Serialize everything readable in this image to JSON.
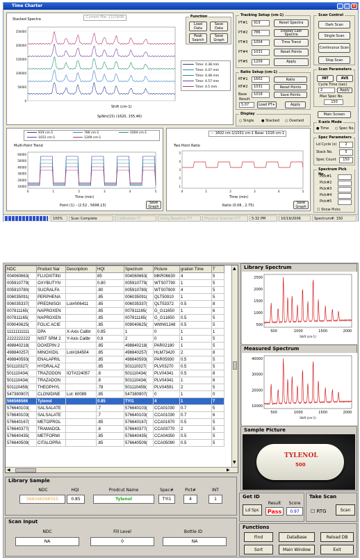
{
  "top": {
    "title": "Time Charter",
    "chart": {
      "label": "Stacked Spectra",
      "caption_box": "Current File: 11/19/06",
      "xlabel": "Shift (cm-1)",
      "readout": "SpNm(15) (1620, 155.46)",
      "y_ticks": [
        "250000",
        "200000",
        "150000",
        "100000",
        "50000",
        "0"
      ],
      "legend": [
        "Time: 4.38 mm",
        "Time: 4.47 mm",
        "Time: 4.48 mm",
        "Time: 4.57 mm",
        "Time: 4.5 mm"
      ]
    },
    "function_group": {
      "label": "Function",
      "buttons": [
        "Load Data",
        "Save Data",
        "Peak Search",
        "Save Graph"
      ]
    },
    "tracking": {
      "label": "Tracking Setup (cm-1)",
      "rows": [
        {
          "name": "PT#1",
          "value": "919",
          "button": "Reset Spectra"
        },
        {
          "name": "PT#2",
          "value": "786",
          "button": "Display Last Spectra"
        },
        {
          "name": "PT#3",
          "value": "1004",
          "button": "Time Trend"
        },
        {
          "name": "PT#4",
          "value": "1031",
          "button": "Reset Points"
        },
        {
          "name": "PT#5",
          "value": "1209",
          "button": "Apply"
        }
      ]
    },
    "ratio": {
      "label": "Ratio Setup (cm-1)",
      "rows": [
        {
          "name": "RT#1",
          "value": "1602",
          "button": "Ratio"
        },
        {
          "name": "RT#2",
          "value": "1031",
          "button": "Reset Points"
        },
        {
          "name": "Base",
          "value": "1016",
          "button": "Save Points"
        }
      ],
      "result_label": "Result",
      "result_value": "5.07",
      "load_button": "Load PT+",
      "apply_button": "Apply"
    },
    "display": {
      "label": "Display",
      "options": [
        "Single",
        "Stacked",
        "Overlaid"
      ]
    },
    "scan_control": {
      "label": "Scan Control",
      "buttons": [
        "Dark Scan",
        "Single Scan",
        "Continuous Scan",
        "Stop Scan"
      ]
    },
    "scan_params": {
      "label": "Scan Parameters",
      "int_label": "INT",
      "ave_label": "AVE",
      "cycle_label": "Cycle Time (sec)",
      "cycle_value": "2",
      "apply": "Apply",
      "max_label": "Max Spec No.",
      "max_value": "150",
      "main_screen": "Main Screen"
    },
    "xaxis_mode": {
      "label": "X-axis Mode",
      "options": [
        "Time",
        "Spec No."
      ]
    },
    "spec_params": {
      "label": "Spec Parameters",
      "rows": [
        {
          "name": "Ld Cycle (s)",
          "value": "2"
        },
        {
          "name": "Stack No.",
          "value": "5"
        },
        {
          "name": "Spec Count",
          "value": "150"
        }
      ]
    },
    "pick": {
      "label": "Spectrum Pick No.",
      "rows": [
        "Pick#1",
        "Pick#2",
        "Pick#3",
        "Pick#4",
        "Pick#5"
      ],
      "show": "Show Picks"
    },
    "trend": {
      "label": "Multi-Point Trend",
      "legend": [
        "919 cm-1",
        "786 cm-1",
        "1004 cm-1",
        "1031 cm-1",
        "1209 cm-1"
      ],
      "xlabel": "Time (min)",
      "readout": "Point (1) - (2.52 , 5698.13)",
      "save": "Save Graph",
      "x_ticks": [
        "0",
        "1",
        "2",
        "3",
        "4",
        "5"
      ],
      "y_ticks": [
        "60000",
        "50000",
        "40000",
        "30000",
        "20000",
        "10000"
      ]
    },
    "tpratio": {
      "label": "Two Point Ratio",
      "legend": "1602 cm-1/1031 cm-1 Base: 1016 cm-1",
      "xlabel": "Time (min)",
      "readout": "Ratio (0.06 , 2.75)",
      "save": "Save Graph",
      "x_ticks": [
        "0",
        "1",
        "2",
        "3",
        "4",
        "5"
      ],
      "y_ticks": [
        "5",
        "4",
        "3",
        "2",
        "1"
      ]
    },
    "status": [
      "100%",
      "Scan Complete",
      "Calibration:??",
      "Using Baseline:???",
      "Physical Scanner:???",
      "5:32 PM",
      "10/19/2006",
      "Spectrum#: 150"
    ]
  },
  "bottom": {
    "table": {
      "columns": [
        "NDC",
        "Product Nar",
        "Description",
        "HQI",
        "Spectrum",
        "Picture",
        "gration Time",
        "T"
      ],
      "rows": [
        [
          "004060663(",
          "FLUOXITINI",
          "",
          "85",
          "004060663(",
          "MKR06630",
          "4",
          "5"
        ],
        [
          "005910779(",
          "OXYBUTYN",
          "",
          "0.80",
          "005910779(",
          "WTS07790",
          "1",
          "5"
        ],
        [
          "005910780(",
          "SUCRALFA",
          "",
          ".80",
          "005910780(",
          "WTS07800",
          "4",
          "5"
        ],
        [
          "006035091(",
          "PERPHENA",
          "",
          ".85",
          "006035091(",
          "QLT50910",
          "1",
          "5"
        ],
        [
          "006035337(",
          "PREDNISOI",
          "Lot#006411",
          ".85",
          "006035337(",
          "QLT53372",
          "0.5",
          "8"
        ],
        [
          "007811165(",
          "NAPROXEN",
          "",
          ".85",
          "007811165(",
          "G_G11650",
          "1",
          "6"
        ],
        [
          "007811165(",
          "NAPROXEN",
          "",
          ".85",
          "007811165(",
          "G_G11650",
          "0.5",
          "5"
        ],
        [
          "009040625(",
          "FOLIC ACIE",
          "",
          ".85",
          "009040625(",
          "WWW1248",
          "0.5",
          "5"
        ],
        [
          "11111111111",
          "DPA",
          "X-Axis Calibr",
          "0.85",
          "1",
          "0",
          "1",
          "1"
        ],
        [
          "2222222222",
          "NIST SRM 2",
          "Y-Axis Calibr",
          "0.8",
          "2",
          "0",
          "1",
          "5"
        ],
        [
          "498840218(",
          "DOXEPIN 2",
          "",
          ".85",
          "498840218(",
          "PAR02180",
          "1",
          "5"
        ],
        [
          "498840257(",
          "MINOXIDIL",
          "Lot#164504",
          ".85",
          "498840257(",
          "HLM73420",
          "2",
          "8"
        ],
        [
          "498840593(",
          "ENALAPRIL",
          "",
          ".85",
          "498840593(",
          "PAR05930",
          "0.5",
          "5"
        ],
        [
          "501110327(",
          "HYDRALAZ",
          "",
          ".85",
          "501110327(",
          "PLV03270",
          "0.5",
          "5"
        ],
        [
          "501110434(",
          "TRAZODON",
          "IOT#224057",
          ".8",
          "501110434(",
          "PLV04341",
          "0.5",
          "8"
        ],
        [
          "501110434(",
          "TRAZADON",
          "",
          ".8",
          "501110434(",
          "PLV04341",
          "1",
          "6"
        ],
        [
          "501110459(",
          "THEOPHYL",
          "",
          ".78",
          "501110459(",
          "PLV04591",
          "2",
          "5"
        ],
        [
          "547380907(",
          "CLONIDINE",
          "Lot: 60089",
          ".85",
          "547380907(",
          "0",
          "1",
          "0"
        ],
        [
          "566566566",
          "Tylenol",
          "",
          "0.85",
          "TYI1",
          "4",
          "1",
          "7"
        ],
        [
          "576640103(",
          "SALSALATE",
          "",
          ".7",
          "576640103(",
          "CCA01030",
          "0.7",
          "5"
        ],
        [
          "576640103(",
          "SALSALATE",
          "",
          ".7",
          "576640103(",
          "CCA01030",
          "0.7",
          "6"
        ],
        [
          "576640167(",
          "METOPROL",
          "",
          ".85",
          "576640167(",
          "CCA01670",
          "0.5",
          "5"
        ],
        [
          "576640377(",
          "TRAMADOL",
          "",
          ".8",
          "576640377(",
          "CCA03770",
          "2",
          "5"
        ],
        [
          "576640435(",
          "METFORMI",
          "",
          ".85",
          "576640435(",
          "CCA04350",
          "0.5",
          "5"
        ],
        [
          "576640509(",
          "CITALOPRA",
          "",
          ".85",
          "576640509(",
          "CCA05090",
          "0.5",
          "5"
        ]
      ],
      "selected_index": 18
    },
    "library_spectrum": {
      "title": "Library Spectrum",
      "xlabel": "Shift (cm-1)",
      "y_ticks": [
        "2500",
        "2000",
        "1500",
        "1000",
        "500"
      ],
      "x_ticks": [
        "500",
        "1000",
        "1500",
        "2000"
      ]
    },
    "measured_spectrum": {
      "title": "Measured Spectrum",
      "xlabel": "Shift (cm-1)",
      "y_ticks": [
        "40000",
        "30000",
        "20000",
        "10000"
      ],
      "x_ticks": [
        "500",
        "1000",
        "1500",
        "2000"
      ]
    },
    "sample_picture": {
      "title": "Sample Picture",
      "pill_text_1": "TYLENOL",
      "pill_text_2": "500"
    },
    "library_sample": {
      "title": "Library Sample",
      "labels": {
        "ndc": "NDC",
        "hqi": "HQI",
        "name": "Prodcut Name",
        "spec": "Spec#",
        "pict": "Pict#",
        "int": "INT"
      },
      "values": {
        "ndc": "566566566555",
        "hqi": "0.85",
        "name": "Tylenol",
        "spec": "TYI1",
        "pict": "4",
        "int": "1"
      }
    },
    "get_id": {
      "title": "Get ID",
      "button": "Ld Spc",
      "result_label": "Result",
      "score_label": "Score",
      "result_value": "Pass",
      "score_value": "0.97"
    },
    "take_scan": {
      "title": "Take Scan",
      "rtg": "RTG",
      "scan": "Scan"
    },
    "scan_input": {
      "title": "Scan Input",
      "labels": {
        "ndc": "NDC",
        "fill": "Fill Level",
        "bottle": "Bottle ID"
      },
      "values": {
        "ndc": "NA",
        "fill": "0",
        "bottle": "NA"
      }
    },
    "functions": {
      "title": "Functions",
      "buttons": [
        "Find",
        "DataBase",
        "Reload DB",
        "Sort",
        "Main Window",
        "Exit"
      ]
    },
    "colors": {
      "ndc_value": "#e8a040",
      "name_value": "#22aa22",
      "pass": "#ff0000",
      "score": "#0000cc",
      "selected_row": "#3169c6"
    }
  }
}
